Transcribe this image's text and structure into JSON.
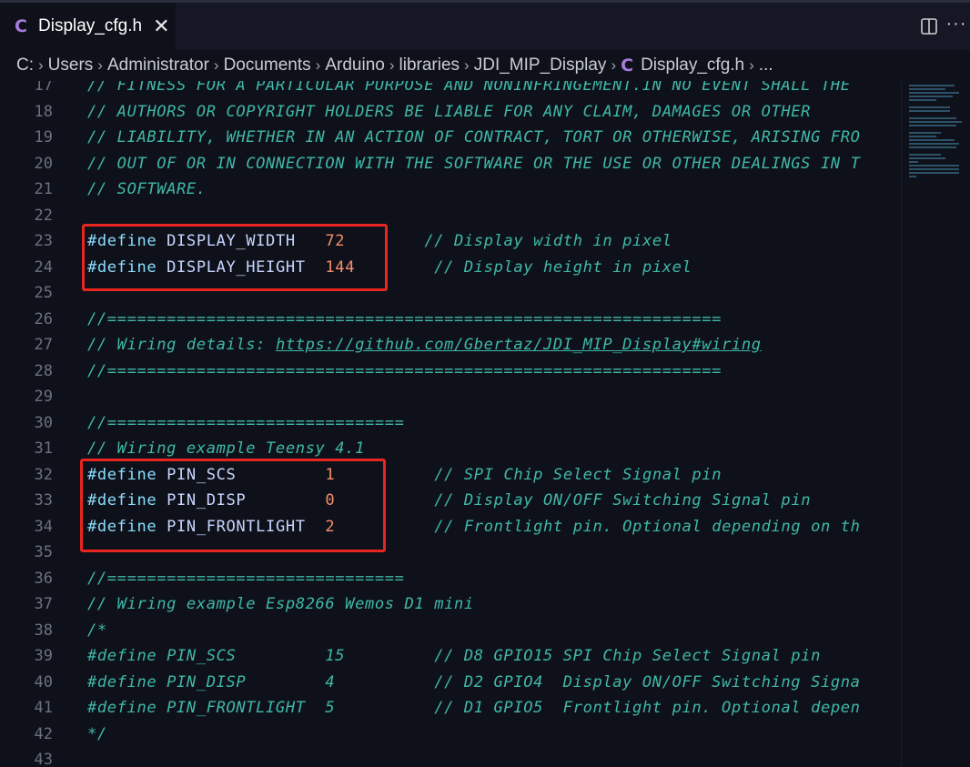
{
  "tab": {
    "icon": "C",
    "title": "Display_cfg.h",
    "close": "✕"
  },
  "actions": {
    "split": "split-editor-icon",
    "more": "···"
  },
  "breadcrumb": [
    "C:",
    "Users",
    "Administrator",
    "Documents",
    "Arduino",
    "libraries",
    "JDI_MIP_Display",
    "Display_cfg.h",
    "..."
  ],
  "breadcrumb_file_icon": "C",
  "colors": {
    "comment": "#3fb8a8",
    "keyword": "#89ddff",
    "identifier": "#c6d6ff",
    "number": "#f78c6c",
    "highlight": "#e8251e"
  },
  "lines": [
    {
      "n": "17",
      "parts": [
        [
          "cm",
          "// FITNESS FOR A PARTICULAR PURPOSE AND NONINFRINGEMENT.IN NO EVENT SHALL THE"
        ]
      ]
    },
    {
      "n": "18",
      "parts": [
        [
          "cm",
          "// AUTHORS OR COPYRIGHT HOLDERS BE LIABLE FOR ANY CLAIM, DAMAGES OR OTHER"
        ]
      ]
    },
    {
      "n": "19",
      "parts": [
        [
          "cm",
          "// LIABILITY, WHETHER IN AN ACTION OF CONTRACT, TORT OR OTHERWISE, ARISING FRO"
        ]
      ]
    },
    {
      "n": "20",
      "parts": [
        [
          "cm",
          "// OUT OF OR IN CONNECTION WITH THE SOFTWARE OR THE USE OR OTHER DEALINGS IN T"
        ]
      ]
    },
    {
      "n": "21",
      "parts": [
        [
          "cm",
          "// SOFTWARE."
        ]
      ]
    },
    {
      "n": "22",
      "parts": []
    },
    {
      "n": "23",
      "parts": [
        [
          "kw",
          "#define"
        ],
        [
          "id",
          " DISPLAY_WIDTH   "
        ],
        [
          "num",
          "72"
        ],
        [
          "id",
          "        "
        ],
        [
          "cm",
          "// Display width in pixel"
        ]
      ]
    },
    {
      "n": "24",
      "parts": [
        [
          "kw",
          "#define"
        ],
        [
          "id",
          " DISPLAY_HEIGHT  "
        ],
        [
          "num",
          "144"
        ],
        [
          "id",
          "        "
        ],
        [
          "cm",
          "// Display height in pixel"
        ]
      ]
    },
    {
      "n": "25",
      "parts": []
    },
    {
      "n": "26",
      "parts": [
        [
          "cm",
          "//=============================================================="
        ]
      ]
    },
    {
      "n": "27",
      "parts": [
        [
          "cm",
          "// Wiring details: "
        ],
        [
          "cm link",
          "https://github.com/Gbertaz/JDI_MIP_Display#wiring"
        ]
      ]
    },
    {
      "n": "28",
      "parts": [
        [
          "cm",
          "//=============================================================="
        ]
      ]
    },
    {
      "n": "29",
      "parts": []
    },
    {
      "n": "30",
      "parts": [
        [
          "cm",
          "//=============================="
        ]
      ]
    },
    {
      "n": "31",
      "parts": [
        [
          "cm",
          "// Wiring example Teensy 4.1"
        ]
      ]
    },
    {
      "n": "32",
      "parts": [
        [
          "kw",
          "#define"
        ],
        [
          "id",
          " PIN_SCS         "
        ],
        [
          "num",
          "1"
        ],
        [
          "id",
          "          "
        ],
        [
          "cm",
          "// SPI Chip Select Signal pin"
        ]
      ]
    },
    {
      "n": "33",
      "parts": [
        [
          "kw",
          "#define"
        ],
        [
          "id",
          " PIN_DISP        "
        ],
        [
          "num",
          "0"
        ],
        [
          "id",
          "          "
        ],
        [
          "cm",
          "// Display ON/OFF Switching Signal pin"
        ]
      ]
    },
    {
      "n": "34",
      "parts": [
        [
          "kw",
          "#define"
        ],
        [
          "id",
          " PIN_FRONTLIGHT  "
        ],
        [
          "num",
          "2"
        ],
        [
          "id",
          "          "
        ],
        [
          "cm",
          "// Frontlight pin. Optional depending on th"
        ]
      ]
    },
    {
      "n": "35",
      "parts": []
    },
    {
      "n": "36",
      "parts": [
        [
          "cm",
          "//=============================="
        ]
      ]
    },
    {
      "n": "37",
      "parts": [
        [
          "cm",
          "// Wiring example Esp8266 Wemos D1 mini"
        ]
      ]
    },
    {
      "n": "38",
      "parts": [
        [
          "cm",
          "/*"
        ]
      ]
    },
    {
      "n": "39",
      "parts": [
        [
          "cm",
          "#define PIN_SCS         15         // D8 GPIO15 SPI Chip Select Signal pin"
        ]
      ]
    },
    {
      "n": "40",
      "parts": [
        [
          "cm",
          "#define PIN_DISP        4          // D2 GPIO4  Display ON/OFF Switching Signa"
        ]
      ]
    },
    {
      "n": "41",
      "parts": [
        [
          "cm",
          "#define PIN_FRONTLIGHT  5          // D1 GPIO5  Frontlight pin. Optional depen"
        ]
      ]
    },
    {
      "n": "42",
      "parts": [
        [
          "cm",
          "*/"
        ]
      ]
    },
    {
      "n": "43",
      "parts": []
    }
  ]
}
